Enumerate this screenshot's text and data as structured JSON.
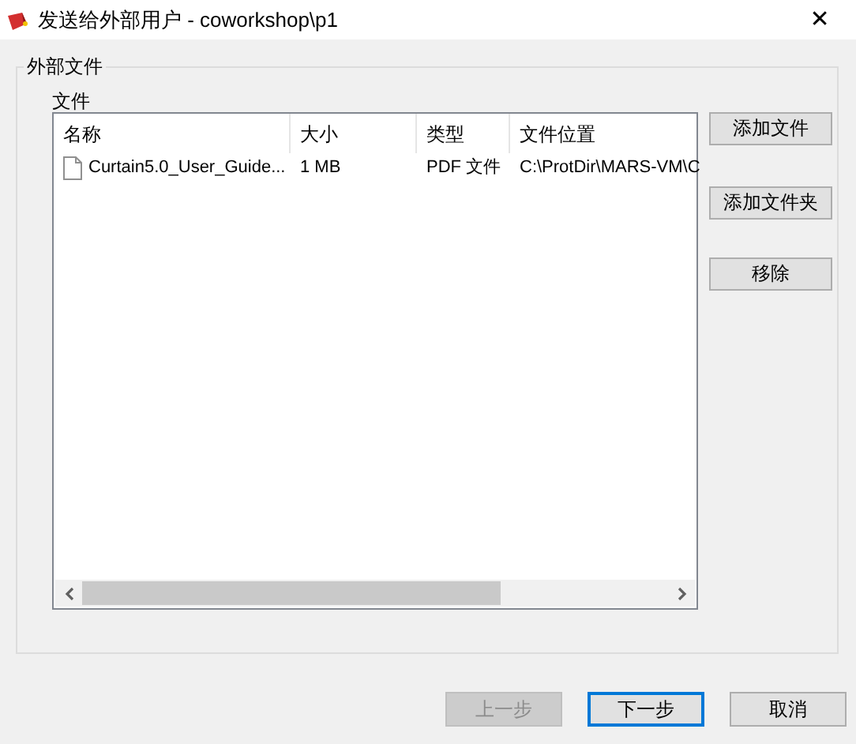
{
  "window": {
    "title": "发送给外部用户 - coworkshop\\p1",
    "close": "✕"
  },
  "group": {
    "title": "外部文件",
    "label": "文件",
    "columns": [
      "名称",
      "大小",
      "类型",
      "文件位置"
    ],
    "rows": [
      {
        "cells": [
          "Curtain5.0_User_Guide...",
          "1 MB",
          "PDF 文件",
          "C:\\ProtDir\\MARS-VM\\C"
        ]
      }
    ],
    "side_buttons": [
      "添加文件",
      "添加文件夹",
      "移除"
    ]
  },
  "footer_buttons": [
    {
      "label": "上一步",
      "disabled": true,
      "focused": false
    },
    {
      "label": "下一步",
      "disabled": false,
      "focused": true
    },
    {
      "label": "取消",
      "disabled": false,
      "focused": false
    }
  ]
}
